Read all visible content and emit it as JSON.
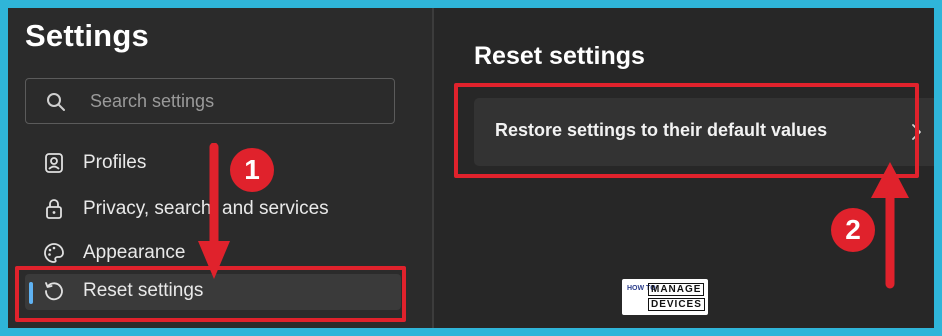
{
  "sidebar": {
    "title": "Settings",
    "search_placeholder": "Search settings",
    "items": [
      {
        "label": "Profiles",
        "icon": "profiles-icon"
      },
      {
        "label": "Privacy, search, and services",
        "icon": "lock-icon"
      },
      {
        "label": "Appearance",
        "icon": "palette-icon"
      },
      {
        "label": "Reset settings",
        "icon": "reset-icon",
        "active": true
      }
    ]
  },
  "main": {
    "title": "Reset settings",
    "restore_label": "Restore settings to their default values"
  },
  "annotations": {
    "step1": "1",
    "step2": "2",
    "color": "#e0222c"
  },
  "watermark": {
    "how_to": "HOW TO",
    "manage": "MANAGE",
    "devices": "DEVICES"
  },
  "colors": {
    "accent": "#5fb2f2",
    "background": "#262626",
    "frame": "#2fb5d9"
  }
}
